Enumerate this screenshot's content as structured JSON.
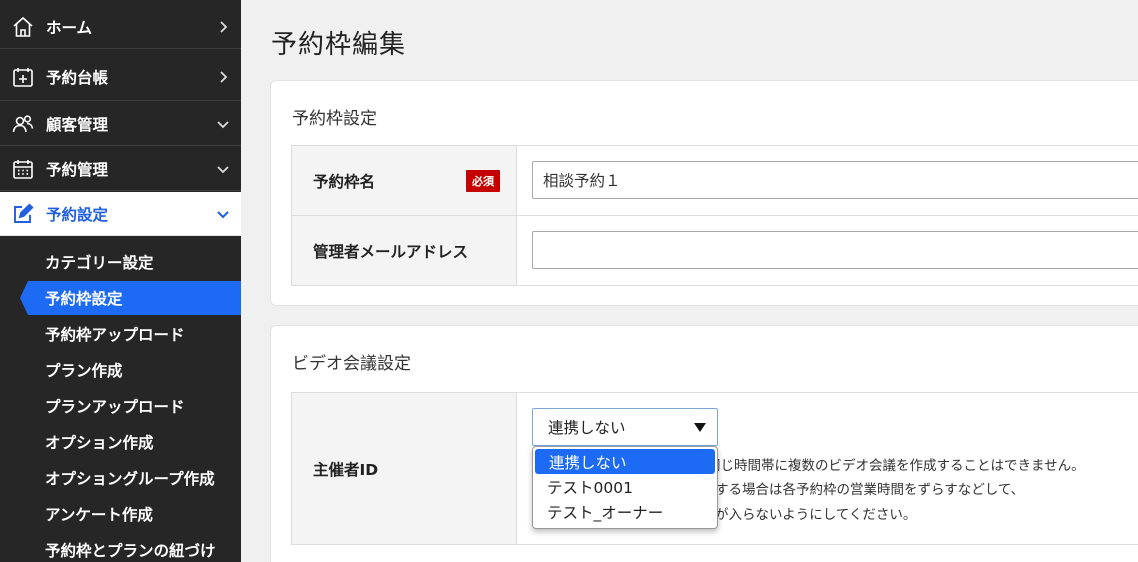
{
  "sidebar": {
    "main": [
      {
        "label": "ホーム",
        "icon": "home-icon",
        "chevron": "right"
      },
      {
        "label": "予約台帳",
        "icon": "calendar-plus-icon",
        "chevron": "right"
      },
      {
        "label": "顧客管理",
        "icon": "users-icon",
        "chevron": "down"
      },
      {
        "label": "予約管理",
        "icon": "calendar-grid-icon",
        "chevron": "down"
      },
      {
        "label": "予約設定",
        "icon": "edit-icon",
        "chevron": "down",
        "active": true
      }
    ],
    "sub": [
      "カテゴリー設定",
      "予約枠設定",
      "予約枠アップロード",
      "プラン作成",
      "プランアップロード",
      "オプション作成",
      "オプショングループ作成",
      "アンケート作成",
      "予約枠とプランの紐づけ"
    ],
    "active_sub": "予約枠設定"
  },
  "page": {
    "title": "予約枠編集"
  },
  "section1": {
    "title": "予約枠設定",
    "name_label": "予約枠名",
    "required_badge": "必須",
    "name_value": "相談予約１",
    "email_label": "管理者メールアドレス",
    "email_value": ""
  },
  "section2": {
    "title": "ビデオ会議設定",
    "host_label": "主催者ID",
    "select_value": "連携しない",
    "options": [
      "連携しない",
      "テスト0001",
      "テスト_オーナー"
    ],
    "note_line1": "同じ時間帯に複数のビデオ会議を作成することはできません。",
    "note_line2": "する場合は各予約枠の営業時間をずらすなどして、",
    "note_line3": "が入らないようにしてください。"
  },
  "colors": {
    "sidebar_bg": "#262626",
    "accent": "#1d6af5",
    "required": "#c40000"
  }
}
